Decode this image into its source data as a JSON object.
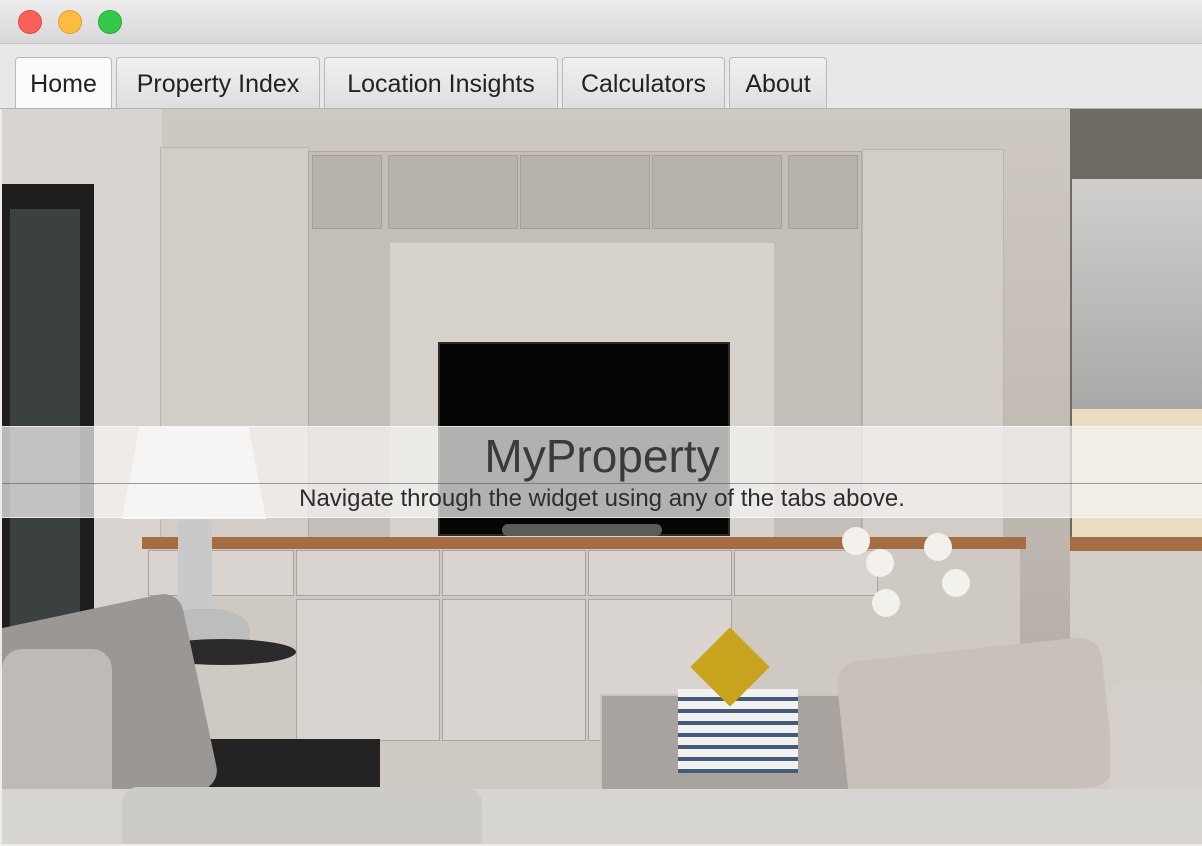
{
  "tabs": [
    {
      "label": "Home",
      "active": true
    },
    {
      "label": "Property Index",
      "active": false
    },
    {
      "label": "Location Insights",
      "active": false
    },
    {
      "label": "Calculators",
      "active": false
    },
    {
      "label": "About",
      "active": false
    }
  ],
  "home": {
    "title": "MyProperty",
    "subtitle": "Navigate through the widget using any of the tabs above."
  },
  "icons": {
    "close": "close-icon",
    "minimize": "minimize-icon",
    "maximize": "maximize-icon"
  },
  "colors": {
    "close": "#fc605b",
    "minimize": "#fdbc40",
    "maximize": "#34c84a"
  }
}
